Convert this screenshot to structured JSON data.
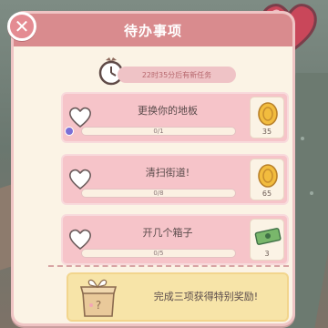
{
  "header": {
    "title": "待办事项",
    "close_label": "✕",
    "hearts": "1"
  },
  "timer": {
    "text": "22时35分后有新任务"
  },
  "tasks": [
    {
      "name": "更换你的地板",
      "progress_text": "0/1",
      "reward_count": "35",
      "reward_icon": "coin-icon"
    },
    {
      "name": "清扫街道!",
      "progress_text": "0/8",
      "reward_count": "65",
      "reward_icon": "coin-icon"
    },
    {
      "name": "开几个箱子",
      "progress_text": "0/5",
      "reward_count": "3",
      "reward_icon": "cash-icon"
    }
  ],
  "bonus": {
    "text": "完成三项获得特别奖励!"
  },
  "colors": {
    "title_bar": "#d98b8e",
    "task_card": "#f6c4c9",
    "bonus_card": "#f7e4a8",
    "panel": "#fbf3e5"
  }
}
